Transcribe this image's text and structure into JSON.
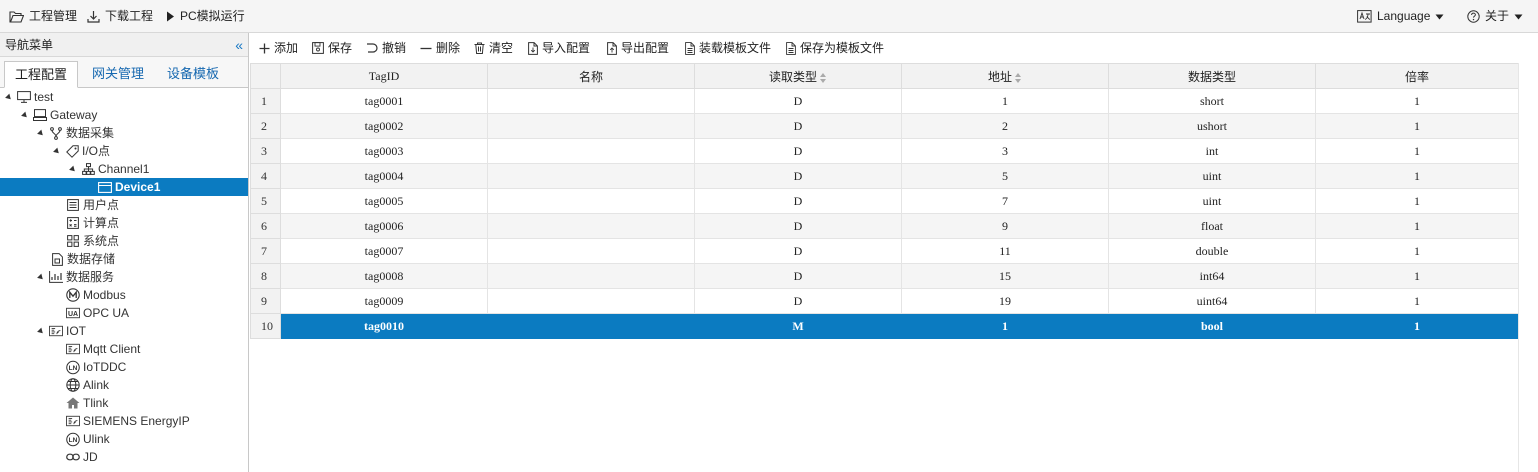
{
  "topbar": {
    "project_mgmt": "工程管理",
    "download_project": "下载工程",
    "pc_sim": "PC模拟运行",
    "language": "Language",
    "about": "关于"
  },
  "nav": {
    "title": "导航菜单",
    "tabs": [
      "工程配置",
      "网关管理",
      "设备模板"
    ],
    "tree": [
      {
        "label": "test",
        "icon": "monitor-icon"
      },
      {
        "label": "Gateway",
        "icon": "gateway-icon"
      },
      {
        "label": "数据采集",
        "icon": "branch-icon"
      },
      {
        "label": "I/O点",
        "icon": "tag-icon"
      },
      {
        "label": "Channel1",
        "icon": "network-icon"
      },
      {
        "label": "Device1",
        "icon": "device-icon"
      },
      {
        "label": "用户点",
        "icon": "list-icon"
      },
      {
        "label": "计算点",
        "icon": "calculator-icon"
      },
      {
        "label": "系统点",
        "icon": "grid-icon"
      },
      {
        "label": "数据存储",
        "icon": "storage-icon"
      },
      {
        "label": "数据服务",
        "icon": "chart-icon"
      },
      {
        "label": "Modbus",
        "icon": "modbus-icon"
      },
      {
        "label": "OPC UA",
        "icon": "opcua-icon"
      },
      {
        "label": "IOT",
        "icon": "iot-icon"
      },
      {
        "label": "Mqtt Client",
        "icon": "iot-icon"
      },
      {
        "label": "IoTDDC",
        "icon": "iotddc-icon"
      },
      {
        "label": "Alink",
        "icon": "globe-icon"
      },
      {
        "label": "Tlink",
        "icon": "home-icon"
      },
      {
        "label": "SIEMENS EnergyIP",
        "icon": "iot-icon"
      },
      {
        "label": "Ulink",
        "icon": "iotddc-icon"
      },
      {
        "label": "JD",
        "icon": "link-icon"
      }
    ]
  },
  "toolbar": {
    "add": "添加",
    "save": "保存",
    "undo": "撤销",
    "delete": "删除",
    "clear": "清空",
    "import": "导入配置",
    "export": "导出配置",
    "load_template": "装载模板文件",
    "save_template": "保存为模板文件"
  },
  "grid": {
    "columns": [
      "TagID",
      "名称",
      "读取类型",
      "地址",
      "数据类型",
      "倍率"
    ],
    "rows": [
      {
        "n": "1",
        "tagid": "tag0001",
        "name": "",
        "read": "D",
        "addr": "1",
        "dtype": "short",
        "rate": "1"
      },
      {
        "n": "2",
        "tagid": "tag0002",
        "name": "",
        "read": "D",
        "addr": "2",
        "dtype": "ushort",
        "rate": "1"
      },
      {
        "n": "3",
        "tagid": "tag0003",
        "name": "",
        "read": "D",
        "addr": "3",
        "dtype": "int",
        "rate": "1"
      },
      {
        "n": "4",
        "tagid": "tag0004",
        "name": "",
        "read": "D",
        "addr": "5",
        "dtype": "uint",
        "rate": "1"
      },
      {
        "n": "5",
        "tagid": "tag0005",
        "name": "",
        "read": "D",
        "addr": "7",
        "dtype": "uint",
        "rate": "1"
      },
      {
        "n": "6",
        "tagid": "tag0006",
        "name": "",
        "read": "D",
        "addr": "9",
        "dtype": "float",
        "rate": "1"
      },
      {
        "n": "7",
        "tagid": "tag0007",
        "name": "",
        "read": "D",
        "addr": "11",
        "dtype": "double",
        "rate": "1"
      },
      {
        "n": "8",
        "tagid": "tag0008",
        "name": "",
        "read": "D",
        "addr": "15",
        "dtype": "int64",
        "rate": "1"
      },
      {
        "n": "9",
        "tagid": "tag0009",
        "name": "",
        "read": "D",
        "addr": "19",
        "dtype": "uint64",
        "rate": "1"
      },
      {
        "n": "10",
        "tagid": "tag0010",
        "name": "",
        "read": "M",
        "addr": "1",
        "dtype": "bool",
        "rate": "1"
      }
    ]
  },
  "colors": {
    "accent": "#0b7bc1",
    "link": "#1668b0"
  }
}
